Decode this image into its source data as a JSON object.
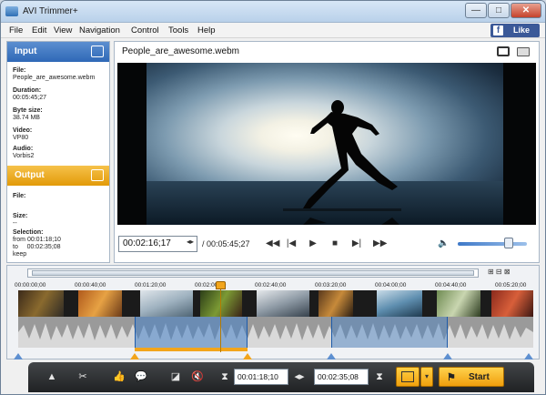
{
  "window": {
    "title": "AVI Trimmer+",
    "minimize": "—",
    "maximize": "□",
    "close": "✕"
  },
  "menu": [
    "File",
    "Edit",
    "View",
    "Navigation",
    "Control",
    "Tools",
    "Help"
  ],
  "facebook": {
    "label": "Like",
    "icon": "f"
  },
  "input_panel": {
    "title": "Input",
    "fields": [
      {
        "label": "File:",
        "value": "People_are_awesome.webm"
      },
      {
        "label": "Duration:",
        "value": "00:05:45;27"
      },
      {
        "label": "Byte size:",
        "value": "38.74 MB"
      },
      {
        "label": "Video:",
        "value": "VP80"
      },
      {
        "label": "Audio:",
        "value": "Vorbis2"
      }
    ]
  },
  "output_panel": {
    "title": "Output",
    "file_label": "File:",
    "size_label": "Size:",
    "size_value": "--",
    "selection_label": "Selection:",
    "from_label": "from",
    "from_value": "00:01:18;10",
    "to_label": "to",
    "to_value": "00:02:35;08",
    "mode": "keep"
  },
  "player": {
    "filename": "People_are_awesome.webm",
    "current_time": "00:02:16;17",
    "duration": "/ 00:05:45;27",
    "volume_level": 0.7
  },
  "timeline": {
    "ticks": [
      "00:00:00;00",
      "00:00:40;00",
      "00:01:20;00",
      "00:02:00;00",
      "00:02:40;00",
      "00:03:20;00",
      "00:04:00;00",
      "00:04:40;00",
      "00:05:20;00"
    ]
  },
  "toolbar": {
    "selection_start": "00:01:18;10",
    "selection_end": "00:02:35;08",
    "start_label": "Start"
  }
}
